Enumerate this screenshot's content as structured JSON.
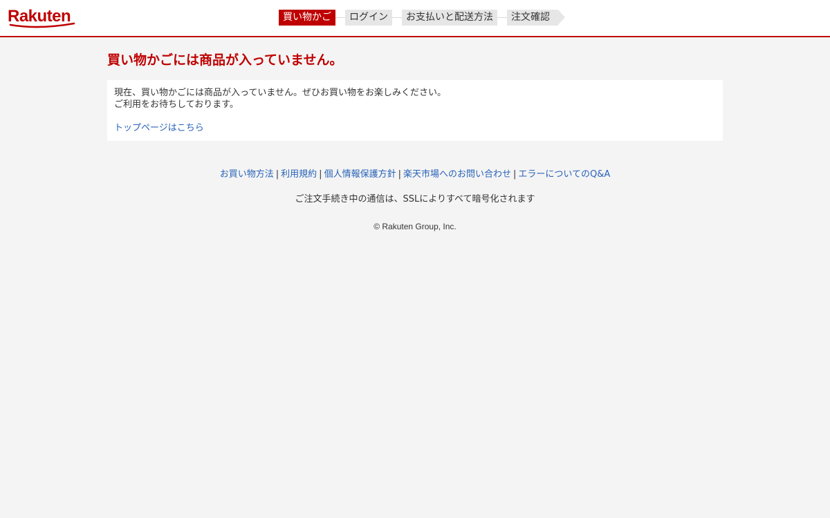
{
  "header": {
    "logo_text": "Rakuten",
    "brand_color": "#bf0000",
    "steps": [
      {
        "label": "買い物かご",
        "active": true
      },
      {
        "label": "ログイン",
        "active": false
      },
      {
        "label": "お支払いと配送方法",
        "active": false
      },
      {
        "label": "注文確認",
        "active": false
      }
    ]
  },
  "main": {
    "title": "買い物かごには商品が入っていません。",
    "message_line1": "現在、買い物かごには商品が入っていません。ぜひお買い物をお楽しみください。",
    "message_line2": "ご利用をお待ちしております。",
    "top_link": "トップページはこちら"
  },
  "footer": {
    "links": [
      "お買い物方法",
      "利用規約",
      "個人情報保護方針",
      "楽天市場へのお問い合わせ",
      "エラーについてのQ&A"
    ],
    "separator": "|",
    "ssl_note": "ご注文手続き中の通信は、SSLによりすべて暗号化されます",
    "copyright": "© Rakuten Group, Inc."
  },
  "colors": {
    "accent": "#bf0000",
    "link": "#2862b8",
    "background": "#f4f4f4"
  }
}
